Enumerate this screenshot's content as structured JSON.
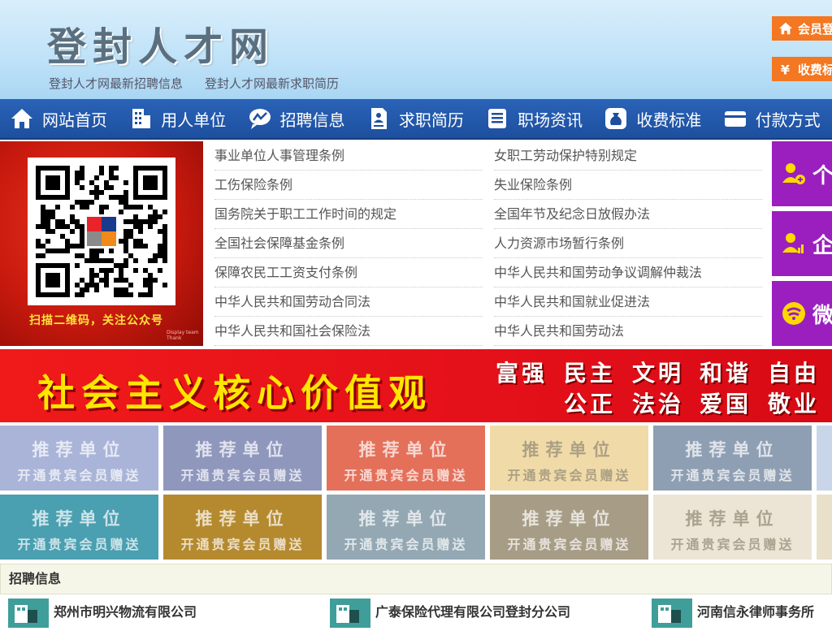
{
  "header": {
    "title": "登封人才网",
    "links": [
      "登封人才网最新招聘信息",
      "登封人才网最新求职简历"
    ],
    "member_login": "会员登",
    "fee": "收费标"
  },
  "nav": [
    {
      "label": "网站首页",
      "icon": "home-icon"
    },
    {
      "label": "用人单位",
      "icon": "building-icon"
    },
    {
      "label": "招聘信息",
      "icon": "chart-bubble-icon"
    },
    {
      "label": "求职简历",
      "icon": "resume-icon"
    },
    {
      "label": "职场资讯",
      "icon": "news-icon"
    },
    {
      "label": "收费标准",
      "icon": "money-bag-icon"
    },
    {
      "label": "付款方式",
      "icon": "card-icon"
    }
  ],
  "qr": {
    "caption": "扫描二维码，关注公众号",
    "small_text": "Display team Thank"
  },
  "laws": [
    "事业单位人事管理条例",
    "女职工劳动保护特别规定",
    "工伤保险条例",
    "失业保险条例",
    "国务院关于职工工作时间的规定",
    "全国年节及纪念日放假办法",
    "全国社会保障基金条例",
    "人力资源市场暂行条例",
    "保障农民工工资支付条例",
    "中华人民共和国劳动争议调解仲裁法",
    "中华人民共和国劳动合同法",
    "中华人民共和国就业促进法",
    "中华人民共和国社会保险法",
    "中华人民共和国劳动法"
  ],
  "side": [
    "个",
    "企",
    "微"
  ],
  "values": {
    "title": "社会主义核心价值观",
    "row1": [
      "富强",
      "民主",
      "文明",
      "和谐",
      "自由"
    ],
    "row2": [
      "公正",
      "法治",
      "爱国",
      "敬业"
    ]
  },
  "tiles": {
    "line1": "推荐单位",
    "line2": "开通贵宾会员赠送",
    "colors": [
      "#a9b4d8",
      "#8f97bd",
      "#e4705a",
      "#f0dba8",
      "#8f9fb3",
      "#4a9fb0",
      "#b58a2f",
      "#93a8b3",
      "#a79c85",
      "#ece5d6"
    ]
  },
  "recruit": {
    "heading": "招聘信息",
    "companies": [
      "郑州市明兴物流有限公司",
      "广泰保险代理有限公司登封分公司",
      "河南信永律师事务所"
    ]
  }
}
